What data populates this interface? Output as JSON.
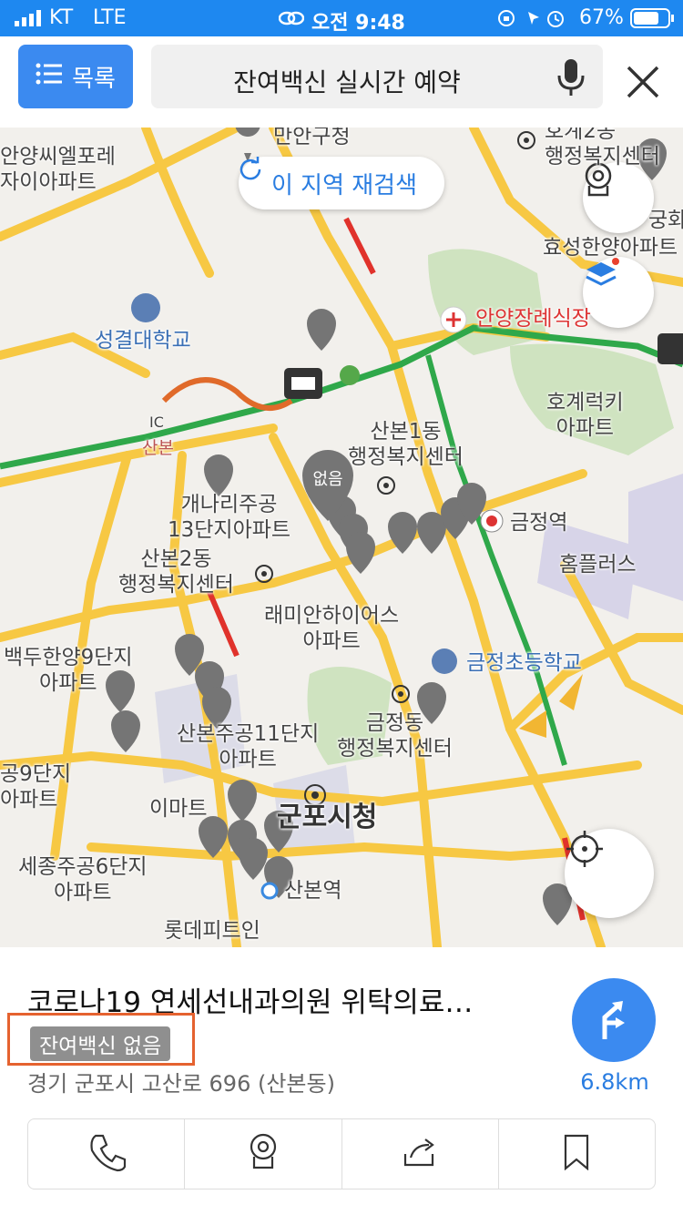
{
  "status_bar": {
    "carrier": "KT",
    "network": "LTE",
    "time": "오전 9:48",
    "battery": "67%"
  },
  "header": {
    "list_label": "목록",
    "search_text": "잔여백신 실시간 예약"
  },
  "map": {
    "rescan_label": "이 지역 재검색",
    "pin_none_label": "없음",
    "labels": {
      "anyang_cl": "안양씨엘포레\n자이아파트",
      "gucheong": "만안구청",
      "hogye2": "호계2동\n행정복지센터",
      "gunghwa": "궁화",
      "hyosung": "효성한양아파트",
      "sungkyul": "성결대학교",
      "anyang_funeral": "안양장례식장",
      "ic": "IC",
      "sanbon_ic": "산본",
      "sanbon1": "산본1동\n행정복지센터",
      "hogye_lucky": "호계럭키\n아파트",
      "gaenari": "개나리주공\n13단지아파트",
      "geumjeong_stn": "금정역",
      "homeplus": "홈플러스",
      "sanbon2": "산본2동\n행정복지센터",
      "raemian": "래미안하이어스\n아파트",
      "baekdu": "백두한양9단지\n아파트",
      "geumjeong_school": "금정초등학교",
      "geumjeong_dong": "금정동\n행정복지센터",
      "sanbon_jugong11": "산본주공11단지\n아파트",
      "jugong9": "공9단지\n아파트",
      "emart": "이마트",
      "gunpo_city": "군포시청",
      "sejong6": "세종주공6단지\n아파트",
      "sanbon_stn": "산본역",
      "lotte": "롯데피트인"
    }
  },
  "place": {
    "title": "코로나19 연세선내과의원 위탁의료…",
    "badge": "잔여백신 없음",
    "address": "경기 군포시 고산로 696 (산본동)",
    "distance": "6.8km"
  },
  "icons": [
    "list-icon",
    "mic-icon",
    "close-icon",
    "refresh-icon",
    "cctv-icon",
    "layers-icon",
    "locate-icon",
    "directions-icon",
    "phone-icon",
    "share-icon",
    "bookmark-icon"
  ]
}
